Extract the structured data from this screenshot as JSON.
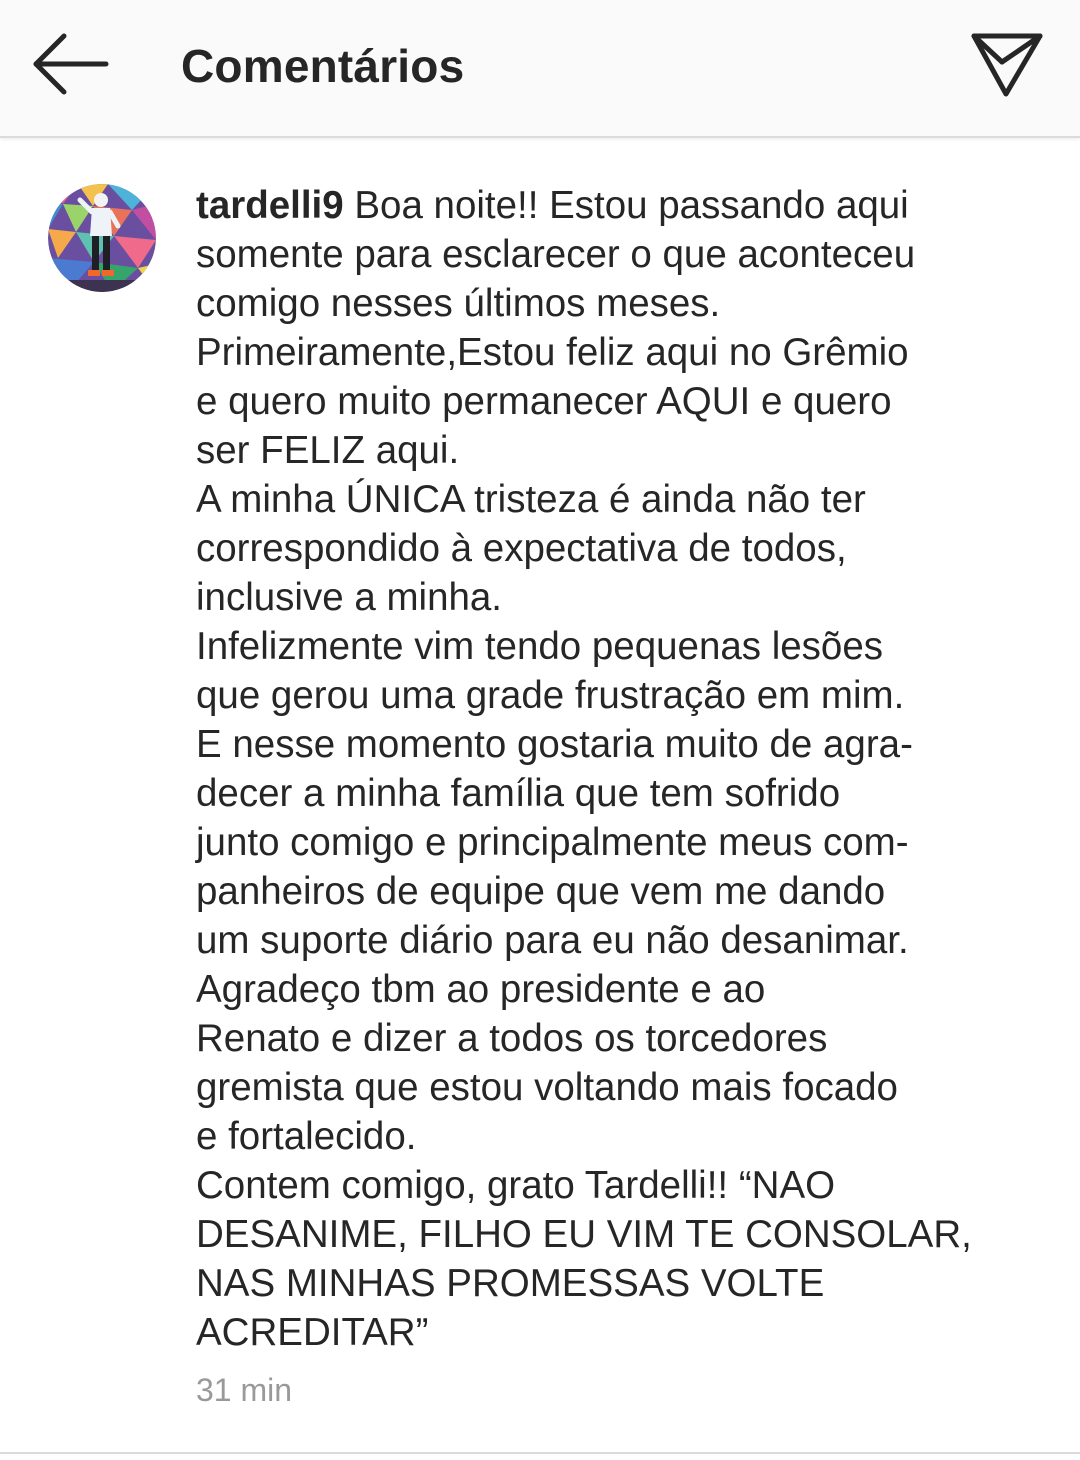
{
  "header": {
    "title": "Comentários",
    "back_icon": "arrow-left-icon",
    "send_icon": "paper-plane-icon"
  },
  "comment": {
    "username": "tardelli9",
    "avatar_icon": "avatar",
    "text": " Boa noite!! Estou passando aqui\nsomente para esclarecer o que aconteceu\ncomigo nesses últimos meses.\n Primeiramente,Estou feliz aqui no Grêmio\ne quero muito permanecer AQUI e quero\nser FELIZ aqui.\nA minha ÚNICA tristeza é ainda  não ter\ncorrespondido à expectativa de todos,\ninclusive a minha.\nInfelizmente vim tendo pequenas lesões\nque gerou uma grade frustração em mim.\nE nesse momento gostaria muito de agra-\ndecer a minha família  que tem sofrido\njunto comigo e principalmente meus com-\npanheiros de equipe que vem me dando\num suporte diário para eu não desanimar.\nAgradeço tbm ao presidente e ao\nRenato e dizer a todos os torcedores\ngremista que estou voltando mais focado\ne fortalecido.\nContem comigo, grato Tardelli!! “NAO\nDESANIME, FILHO EU VIM TE CONSOLAR,\nNAS MINHAS PROMESSAS VOLTE\nACREDITAR”",
    "timestamp": "31 min"
  },
  "colors": {
    "header_bg": "#fafafa",
    "text": "#262626",
    "muted": "#999999",
    "divider": "#dbdbdb"
  }
}
